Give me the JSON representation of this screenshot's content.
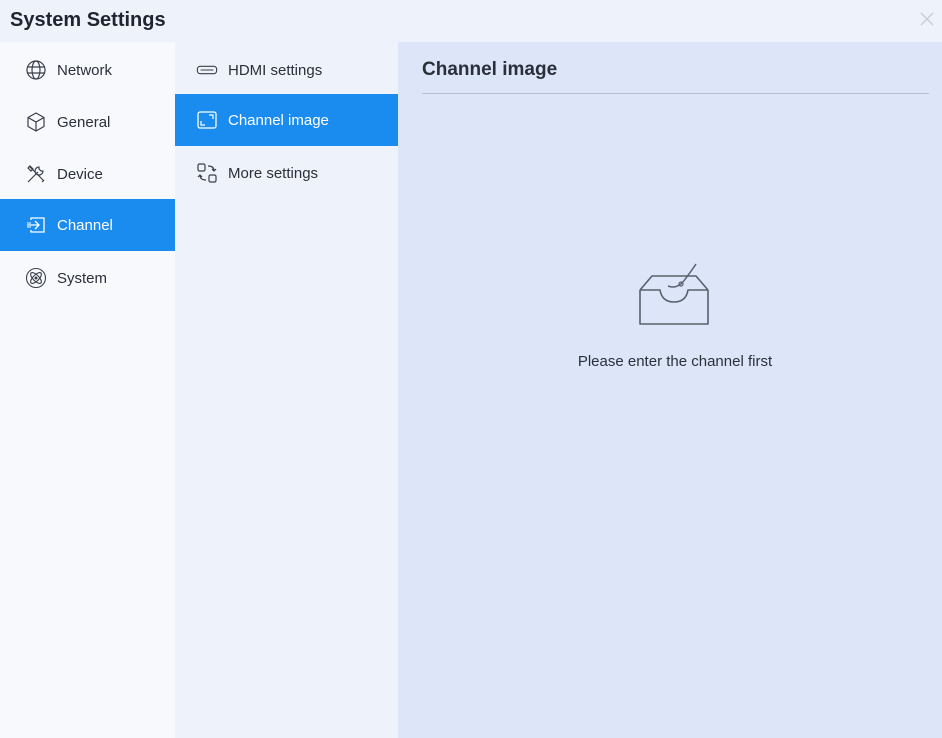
{
  "window": {
    "title": "System Settings",
    "close_icon": "close-icon"
  },
  "nav_primary": {
    "items": [
      {
        "label": "Network",
        "icon": "globe-icon",
        "active": false
      },
      {
        "label": "General",
        "icon": "cube-icon",
        "active": false
      },
      {
        "label": "Device",
        "icon": "tools-icon",
        "active": false
      },
      {
        "label": "Channel",
        "icon": "input-icon",
        "active": true
      },
      {
        "label": "System",
        "icon": "atom-icon",
        "active": false
      }
    ]
  },
  "nav_secondary": {
    "items": [
      {
        "label": "HDMI settings",
        "icon": "hdmi-icon",
        "active": false
      },
      {
        "label": "Channel image",
        "icon": "frame-icon",
        "active": true
      },
      {
        "label": "More settings",
        "icon": "swap-icon",
        "active": false
      }
    ]
  },
  "content": {
    "title": "Channel image",
    "empty_icon": "empty-tray-icon",
    "empty_message": "Please enter the channel first"
  },
  "colors": {
    "accent": "#1a8cf0",
    "content_bg": "#dde6f9",
    "sidebar_bg": "#f8f9fd"
  }
}
